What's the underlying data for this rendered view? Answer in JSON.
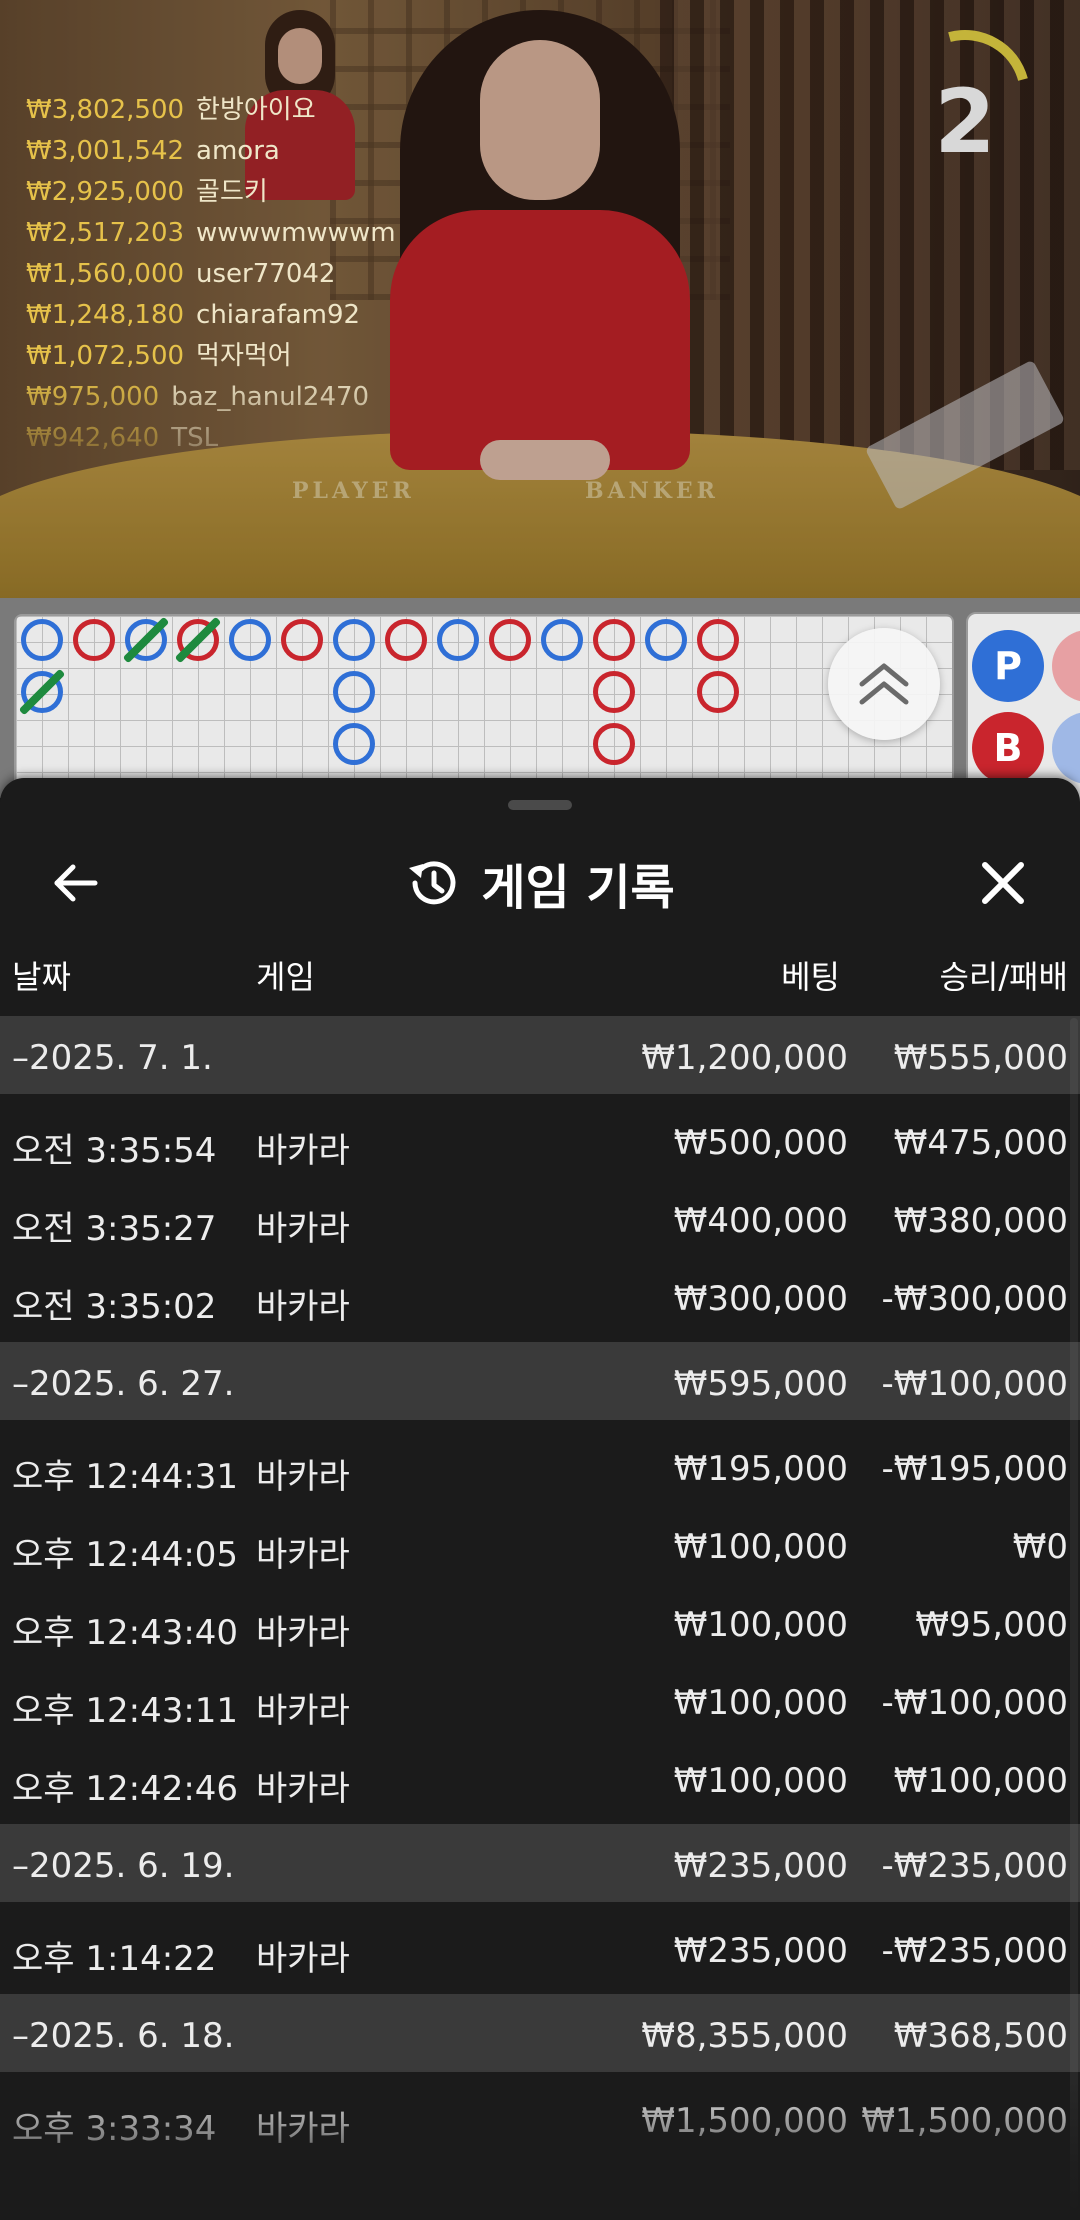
{
  "live_table": {
    "countdown": "2",
    "table_labels": [
      "PLAYER",
      "BANKER"
    ],
    "recent_winners": [
      {
        "amount": "₩3,802,500",
        "name": "한방아이요"
      },
      {
        "amount": "₩3,001,542",
        "name": "amora"
      },
      {
        "amount": "₩2,925,000",
        "name": "골드키"
      },
      {
        "amount": "₩2,517,203",
        "name": "wwwwmwwwm"
      },
      {
        "amount": "₩1,560,000",
        "name": "user77042"
      },
      {
        "amount": "₩1,248,180",
        "name": "chiarafam92"
      },
      {
        "amount": "₩1,072,500",
        "name": "먹자먹어"
      },
      {
        "amount": "₩975,000",
        "name": "baz_hanul2470"
      },
      {
        "amount": "₩942,640",
        "name": "TSL"
      }
    ]
  },
  "road": {
    "side_chips": [
      "P",
      "B"
    ],
    "colors": {
      "player": "#2f6fd6",
      "banker": "#c9252d",
      "tie": "#1e8a3e"
    }
  },
  "history_panel": {
    "title": "게임 기록",
    "columns": {
      "date": "날짜",
      "game": "게임",
      "bet": "베팅",
      "result": "승리/패배"
    },
    "groups": [
      {
        "date": "–2025. 7. 1.",
        "bet": "₩1,200,000",
        "result": "₩555,000",
        "rows": [
          {
            "time": "오전 3:35:54",
            "game": "바카라",
            "bet": "₩500,000",
            "result": "₩475,000"
          },
          {
            "time": "오전 3:35:27",
            "game": "바카라",
            "bet": "₩400,000",
            "result": "₩380,000"
          },
          {
            "time": "오전 3:35:02",
            "game": "바카라",
            "bet": "₩300,000",
            "result": "-₩300,000"
          }
        ]
      },
      {
        "date": "–2025. 6. 27.",
        "bet": "₩595,000",
        "result": "-₩100,000",
        "rows": [
          {
            "time": "오후 12:44:31",
            "game": "바카라",
            "bet": "₩195,000",
            "result": "-₩195,000"
          },
          {
            "time": "오후 12:44:05",
            "game": "바카라",
            "bet": "₩100,000",
            "result": "₩0"
          },
          {
            "time": "오후 12:43:40",
            "game": "바카라",
            "bet": "₩100,000",
            "result": "₩95,000"
          },
          {
            "time": "오후 12:43:11",
            "game": "바카라",
            "bet": "₩100,000",
            "result": "-₩100,000"
          },
          {
            "time": "오후 12:42:46",
            "game": "바카라",
            "bet": "₩100,000",
            "result": "₩100,000"
          }
        ]
      },
      {
        "date": "–2025. 6. 19.",
        "bet": "₩235,000",
        "result": "-₩235,000",
        "rows": [
          {
            "time": "오후 1:14:22",
            "game": "바카라",
            "bet": "₩235,000",
            "result": "-₩235,000"
          }
        ]
      },
      {
        "date": "–2025. 6. 18.",
        "bet": "₩8,355,000",
        "result": "₩368,500",
        "rows": [
          {
            "time": "오후 3:33:34",
            "game": "바카라",
            "bet": "₩1,500,000",
            "result": "₩1,500,000"
          }
        ]
      }
    ]
  }
}
